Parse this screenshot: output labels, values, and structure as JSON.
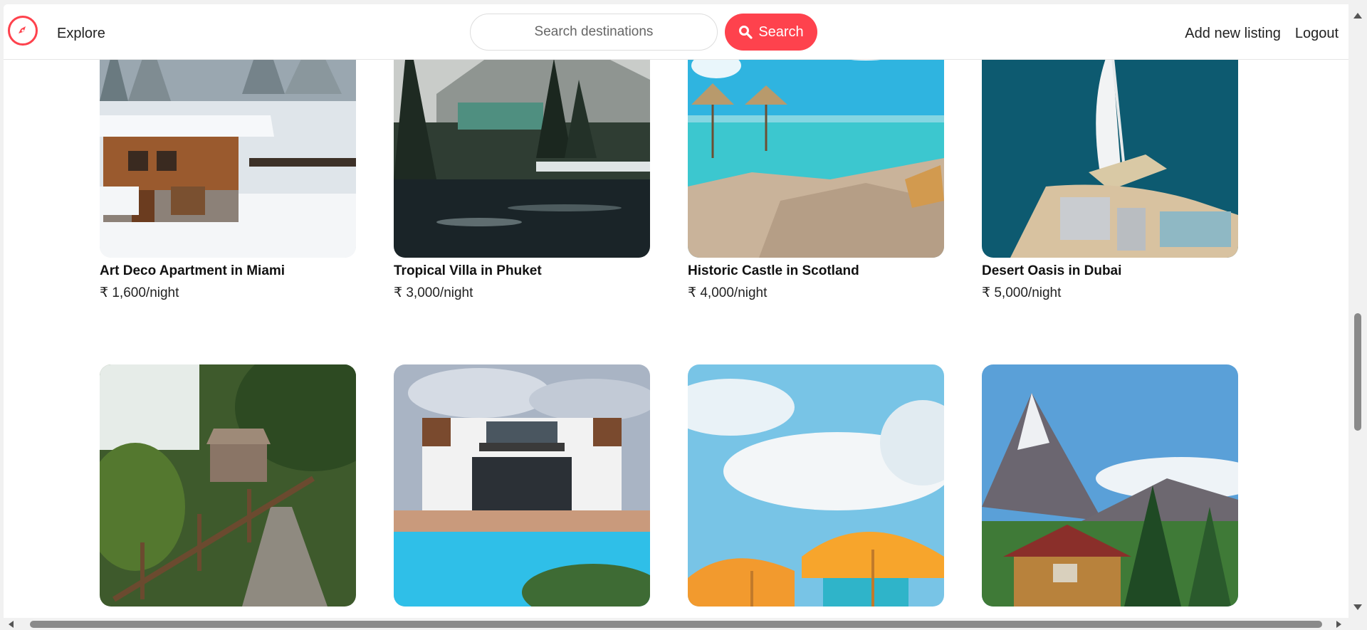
{
  "navbar": {
    "brand_icon": "compass-icon",
    "explore_label": "Explore",
    "search_placeholder": "Search destinations",
    "search_button_label": "Search",
    "add_listing_label": "Add new listing",
    "logout_label": "Logout",
    "accent_color": "#fe424d"
  },
  "listings": [
    {
      "title": "Art Deco Apartment in Miami",
      "price": "₹ 1,600/night",
      "image": "snowy-chalet"
    },
    {
      "title": "Tropical Villa in Phuket",
      "price": "₹ 3,000/night",
      "image": "mountain-lake-cabin"
    },
    {
      "title": "Historic Castle in Scotland",
      "price": "₹ 4,000/night",
      "image": "tropical-beach-umbrellas"
    },
    {
      "title": "Desert Oasis in Dubai",
      "price": "₹ 5,000/night",
      "image": "dubai-burj-al-arab"
    },
    {
      "title": "",
      "price": "",
      "image": "forest-path-cottage"
    },
    {
      "title": "",
      "price": "",
      "image": "modern-villa-pool"
    },
    {
      "title": "",
      "price": "",
      "image": "orange-beach-umbrellas"
    },
    {
      "title": "",
      "price": "",
      "image": "mountain-log-cabin"
    }
  ]
}
